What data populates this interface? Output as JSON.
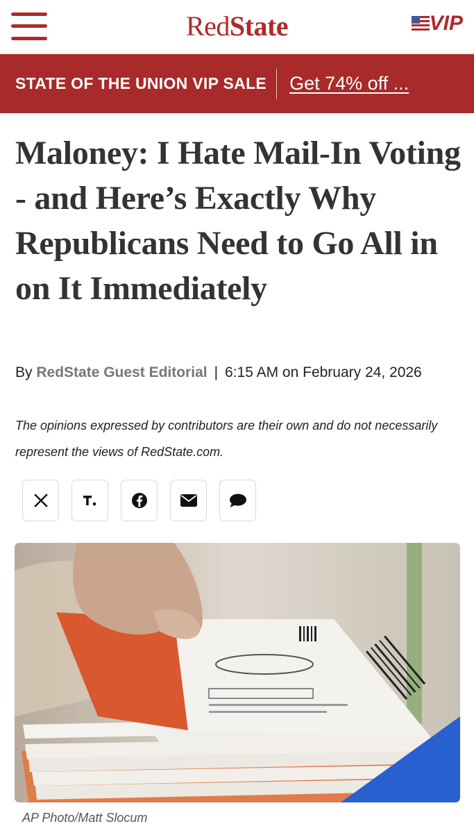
{
  "header": {
    "logo_red": "Red",
    "logo_state": "State",
    "vip_label": "VIP",
    "menu_icon": "hamburger-menu-icon",
    "flag_icon": "us-flag-icon"
  },
  "promo": {
    "label": "STATE OF THE UNION VIP SALE",
    "link": "Get 74% off ..."
  },
  "article": {
    "title": "Maloney: I Hate Mail-In Voting - and Here’s Exactly Why Republicans Need to Go All in on It Immediately",
    "by_prefix": "By",
    "author": "RedState Guest Editorial",
    "separator": "|",
    "timestamp": "6:15 AM on February 24, 2026",
    "disclaimer": "The opinions expressed by contributors are their own and do not necessarily represent the views of RedState.com.",
    "share_icons": [
      "x-icon",
      "truth-social-icon",
      "facebook-icon",
      "email-icon",
      "comment-icon"
    ],
    "image_caption": "AP Photo/Matt Slocum"
  },
  "colors": {
    "brand_red": "#b02a2a",
    "promo_bg": "#a82a2a",
    "title_text": "#333333"
  }
}
